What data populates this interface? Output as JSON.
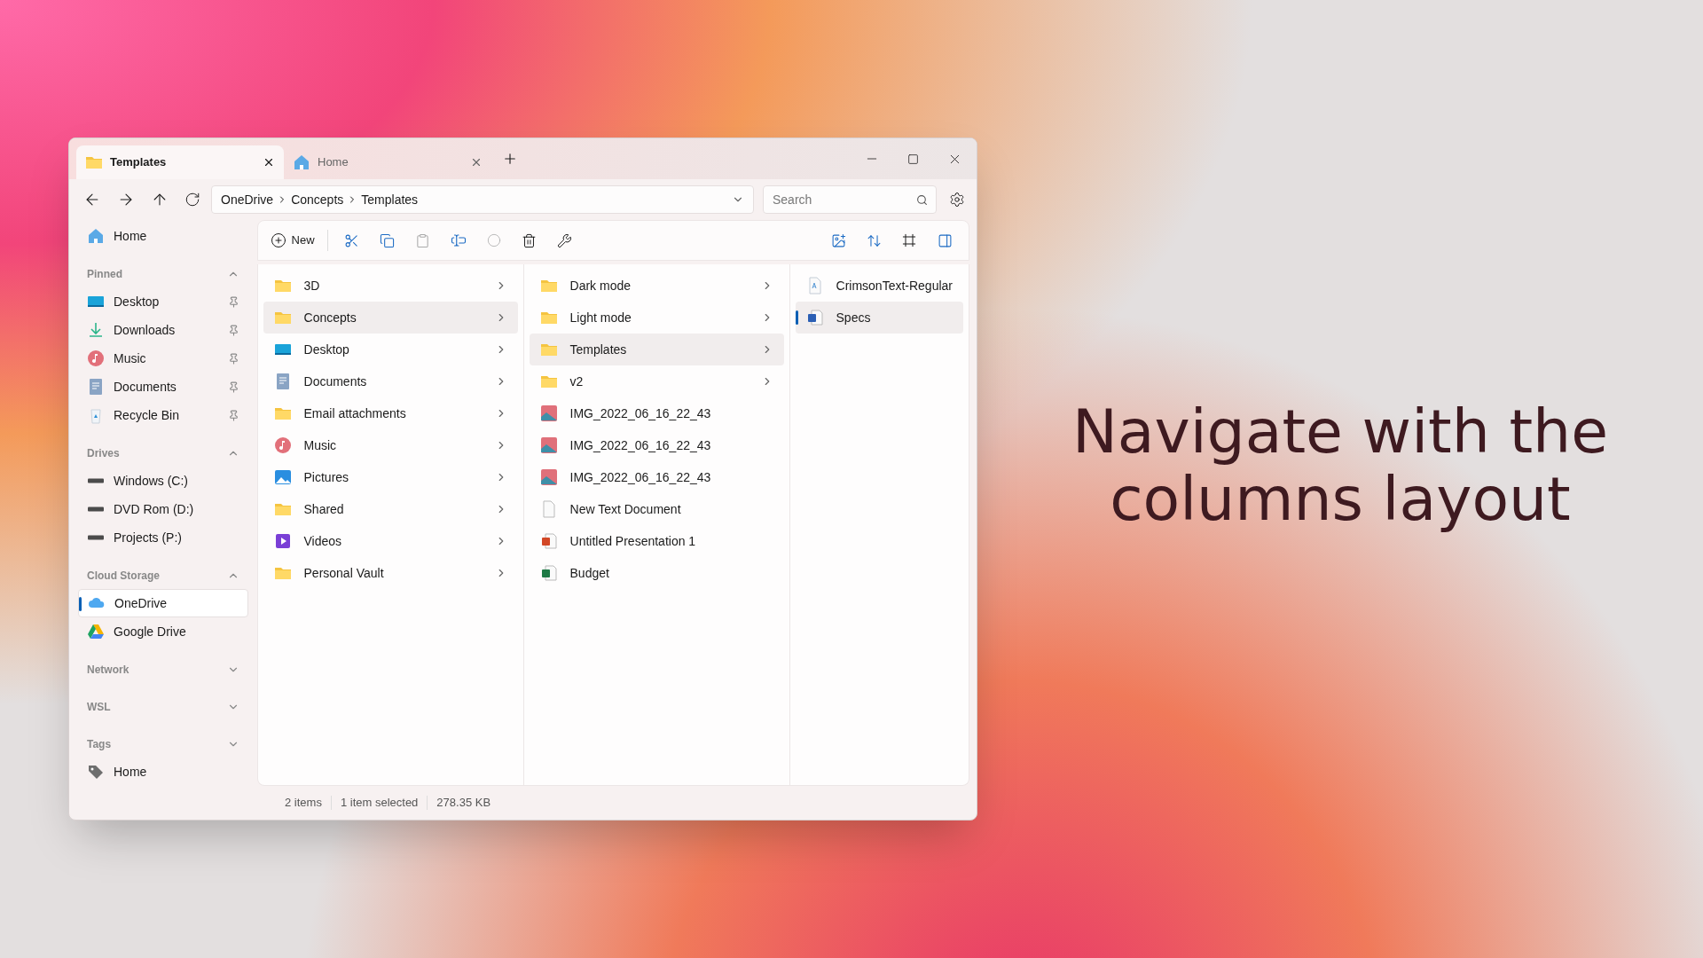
{
  "tabs": [
    {
      "label": "Templates",
      "kind": "folder",
      "selected": true
    },
    {
      "label": "Home",
      "kind": "home",
      "selected": false
    }
  ],
  "address": {
    "segments": [
      "OneDrive",
      "Concepts",
      "Templates"
    ]
  },
  "search": {
    "placeholder": "Search"
  },
  "toolbar": {
    "new_label": "New"
  },
  "sidebar": {
    "home": "Home",
    "sections": [
      {
        "title": "Pinned",
        "expanded": true,
        "items": [
          {
            "label": "Desktop",
            "kind": "desktop",
            "pinned": true,
            "selected": false
          },
          {
            "label": "Downloads",
            "kind": "download",
            "pinned": true,
            "selected": false
          },
          {
            "label": "Music",
            "kind": "music",
            "pinned": true,
            "selected": false
          },
          {
            "label": "Documents",
            "kind": "documents",
            "pinned": true,
            "selected": false
          },
          {
            "label": "Recycle Bin",
            "kind": "recycle",
            "pinned": true,
            "selected": false
          }
        ]
      },
      {
        "title": "Drives",
        "expanded": true,
        "items": [
          {
            "label": "Windows (C:)",
            "kind": "drive",
            "pinned": false,
            "selected": false
          },
          {
            "label": "DVD Rom (D:)",
            "kind": "drive",
            "pinned": false,
            "selected": false
          },
          {
            "label": "Projects (P:)",
            "kind": "drive",
            "pinned": false,
            "selected": false
          }
        ]
      },
      {
        "title": "Cloud Storage",
        "expanded": true,
        "items": [
          {
            "label": "OneDrive",
            "kind": "cloud",
            "pinned": false,
            "selected": true
          },
          {
            "label": "Google Drive",
            "kind": "gdrive",
            "pinned": false,
            "selected": false
          }
        ]
      },
      {
        "title": "Network",
        "expanded": false
      },
      {
        "title": "WSL",
        "expanded": false
      },
      {
        "title": "Tags",
        "expanded": false,
        "items": [
          {
            "label": "Home",
            "kind": "tag",
            "pinned": false,
            "selected": false
          }
        ]
      }
    ]
  },
  "columns": [
    [
      {
        "label": "3D",
        "kind": "folder",
        "has_children": true,
        "selected": false
      },
      {
        "label": "Concepts",
        "kind": "folder",
        "has_children": true,
        "selected": true
      },
      {
        "label": "Desktop",
        "kind": "desktop",
        "has_children": true,
        "selected": false
      },
      {
        "label": "Documents",
        "kind": "documents",
        "has_children": true,
        "selected": false
      },
      {
        "label": "Email attachments",
        "kind": "folder",
        "has_children": true,
        "selected": false
      },
      {
        "label": "Music",
        "kind": "music",
        "has_children": true,
        "selected": false
      },
      {
        "label": "Pictures",
        "kind": "pictures",
        "has_children": true,
        "selected": false
      },
      {
        "label": "Shared",
        "kind": "folder",
        "has_children": true,
        "selected": false
      },
      {
        "label": "Videos",
        "kind": "videos",
        "has_children": true,
        "selected": false
      },
      {
        "label": "Personal Vault",
        "kind": "folder",
        "has_children": true,
        "selected": false
      }
    ],
    [
      {
        "label": "Dark mode",
        "kind": "folder",
        "has_children": true,
        "selected": false
      },
      {
        "label": "Light mode",
        "kind": "folder",
        "has_children": true,
        "selected": false
      },
      {
        "label": "Templates",
        "kind": "folder",
        "has_children": true,
        "selected": true
      },
      {
        "label": "v2",
        "kind": "folder",
        "has_children": true,
        "selected": false
      },
      {
        "label": "IMG_2022_06_16_22_43",
        "kind": "image",
        "has_children": false,
        "selected": false
      },
      {
        "label": "IMG_2022_06_16_22_43",
        "kind": "image",
        "has_children": false,
        "selected": false
      },
      {
        "label": "IMG_2022_06_16_22_43",
        "kind": "image",
        "has_children": false,
        "selected": false
      },
      {
        "label": "New Text Document",
        "kind": "text",
        "has_children": false,
        "selected": false
      },
      {
        "label": "Untitled Presentation 1",
        "kind": "powerpoint",
        "has_children": false,
        "selected": false
      },
      {
        "label": "Budget",
        "kind": "excel",
        "has_children": false,
        "selected": false
      }
    ],
    [
      {
        "label": "CrimsonText-Regular",
        "kind": "font",
        "has_children": false,
        "selected": false
      },
      {
        "label": "Specs",
        "kind": "word",
        "has_children": false,
        "selected": true
      }
    ]
  ],
  "status_bar": [
    "2 items",
    "1 item selected",
    "278.35 KB"
  ],
  "headline": "Navigate with the columns layout"
}
